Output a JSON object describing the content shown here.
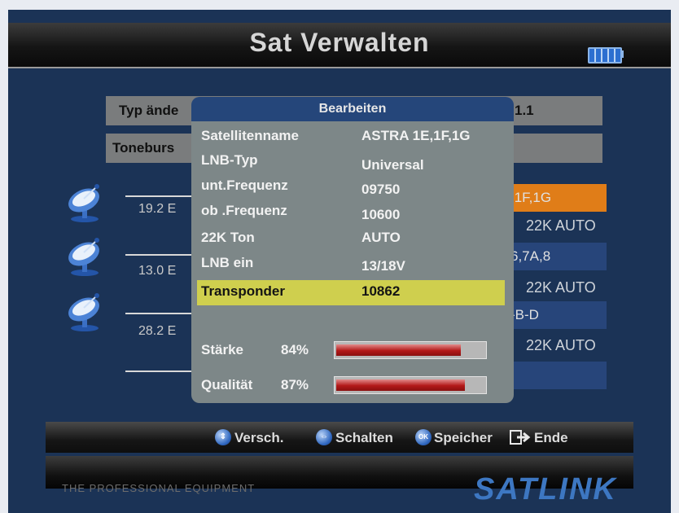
{
  "header": {
    "title": "Sat Verwalten",
    "battery_icon": "battery-icon"
  },
  "settings": {
    "typ_label": "Typ ände",
    "typ_value": "1.1",
    "toneburst_label": "Toneburs"
  },
  "satellites": [
    {
      "position": "19.2 E",
      "name": ",1F,1G",
      "mode": "22K AUTO",
      "selected": true
    },
    {
      "position": "13.0 E",
      "name": "6,7A,8",
      "mode": "22K AUTO",
      "selected": false
    },
    {
      "position": "28.2 E",
      "name": "-B-D",
      "mode": "22K AUTO",
      "selected": false
    }
  ],
  "dialog": {
    "title": "Bearbeiten",
    "fields": [
      {
        "label": "Satellitenname",
        "value": "ASTRA 1E,1F,1G"
      },
      {
        "label": "LNB-Typ",
        "value": "Universal"
      },
      {
        "label": "unt.Frequenz",
        "value": "09750"
      },
      {
        "label": "ob .Frequenz",
        "value": "10600"
      },
      {
        "label": "22K Ton",
        "value": "AUTO"
      },
      {
        "label": "LNB ein",
        "value": "13/18V"
      },
      {
        "label": "Transponder",
        "value": "10862"
      }
    ],
    "signal": {
      "strength_label": "Stärke",
      "strength_value": "84%",
      "strength_level": 84,
      "quality_label": "Qualität",
      "quality_value": "87%",
      "quality_level": 87
    }
  },
  "footer": {
    "hints": [
      {
        "icon": "up-down-arrows-icon",
        "label": "Versch."
      },
      {
        "icon": "left-right-arrows-icon",
        "label": "Schalten"
      },
      {
        "icon": "ok-button-icon",
        "label": "Speicher"
      },
      {
        "icon": "exit-arrow-icon",
        "label": "Ende"
      }
    ]
  },
  "branding": {
    "left": "THE PROFESSIONAL EQUIPMENT",
    "right": "SATLINK"
  },
  "colors": {
    "screen_bg": "#1b3356",
    "selected_row": "#e07d18",
    "highlight": "#cfcf4e",
    "dialog_header": "#25467a",
    "bar_fill": "#b21818"
  }
}
